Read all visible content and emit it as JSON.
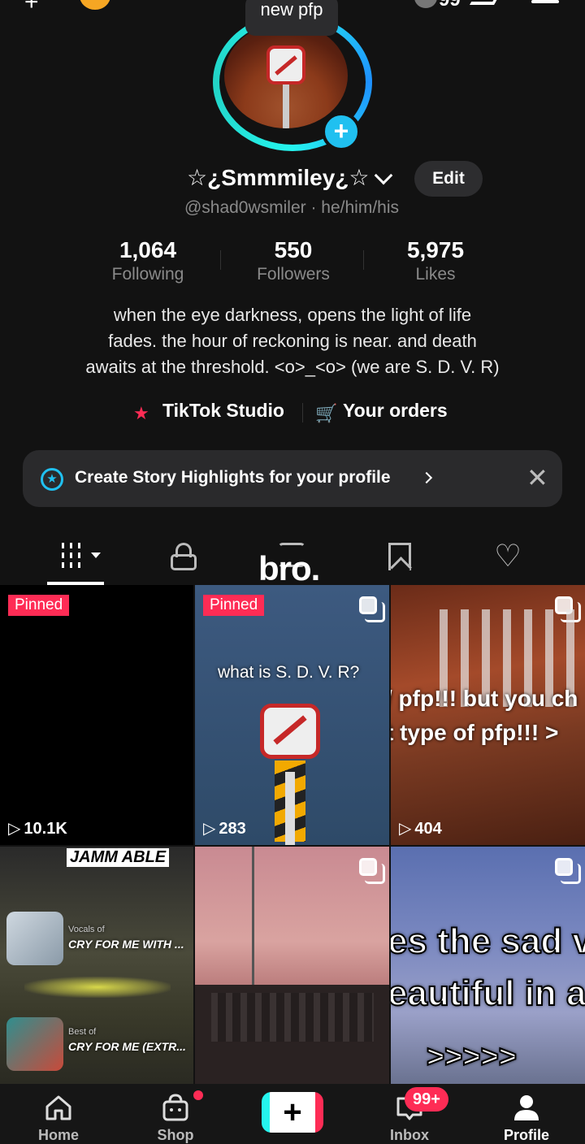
{
  "tooltip": "new pfp",
  "profile": {
    "display_name": "☆¿Smmmiley¿☆",
    "handle": "@shad0wsmiler · he/him/his",
    "edit_label": "Edit",
    "bio_lines": [
      "when the eye darkness, opens the light of life",
      "fades. the hour of reckoning is near. and death",
      "awaits at the threshold. <o>_<o> (we are S. D. V. R)"
    ]
  },
  "stats": [
    {
      "value": "1,064",
      "label": "Following"
    },
    {
      "value": "550",
      "label": "Followers"
    },
    {
      "value": "5,975",
      "label": "Likes"
    }
  ],
  "links": {
    "studio": "TikTok Studio",
    "orders": "Your orders"
  },
  "story_banner": {
    "text": "Create Story Highlights for your profile",
    "close": "✕"
  },
  "overlay_text": "bro.",
  "videos": [
    {
      "pinned": "Pinned",
      "views": "10.1K"
    },
    {
      "pinned": "Pinned",
      "caption": "what is S. D. V. R?",
      "views": "283"
    },
    {
      "caption_lines": [
        "/ pfp!!! but you ch",
        "t type of pfp!!! >"
      ],
      "views": "404"
    },
    {
      "brand": "JAMM ABLE",
      "track1_small": "Vocals of",
      "track1": "CRY FOR ME WITH ...",
      "track2_small": "Best of",
      "track2": "CRY FOR ME (EXTR..."
    },
    {},
    {
      "caption_lines": [
        "es the sad v",
        "eautiful in a",
        ">>>>>"
      ]
    }
  ],
  "nav": {
    "home": "Home",
    "shop": "Shop",
    "inbox": "Inbox",
    "inbox_badge": "99+",
    "profile": "Profile",
    "create": "+"
  },
  "colors": {
    "accent_red": "#fe2c55",
    "accent_cyan": "#25f4ee",
    "background": "#121212"
  }
}
